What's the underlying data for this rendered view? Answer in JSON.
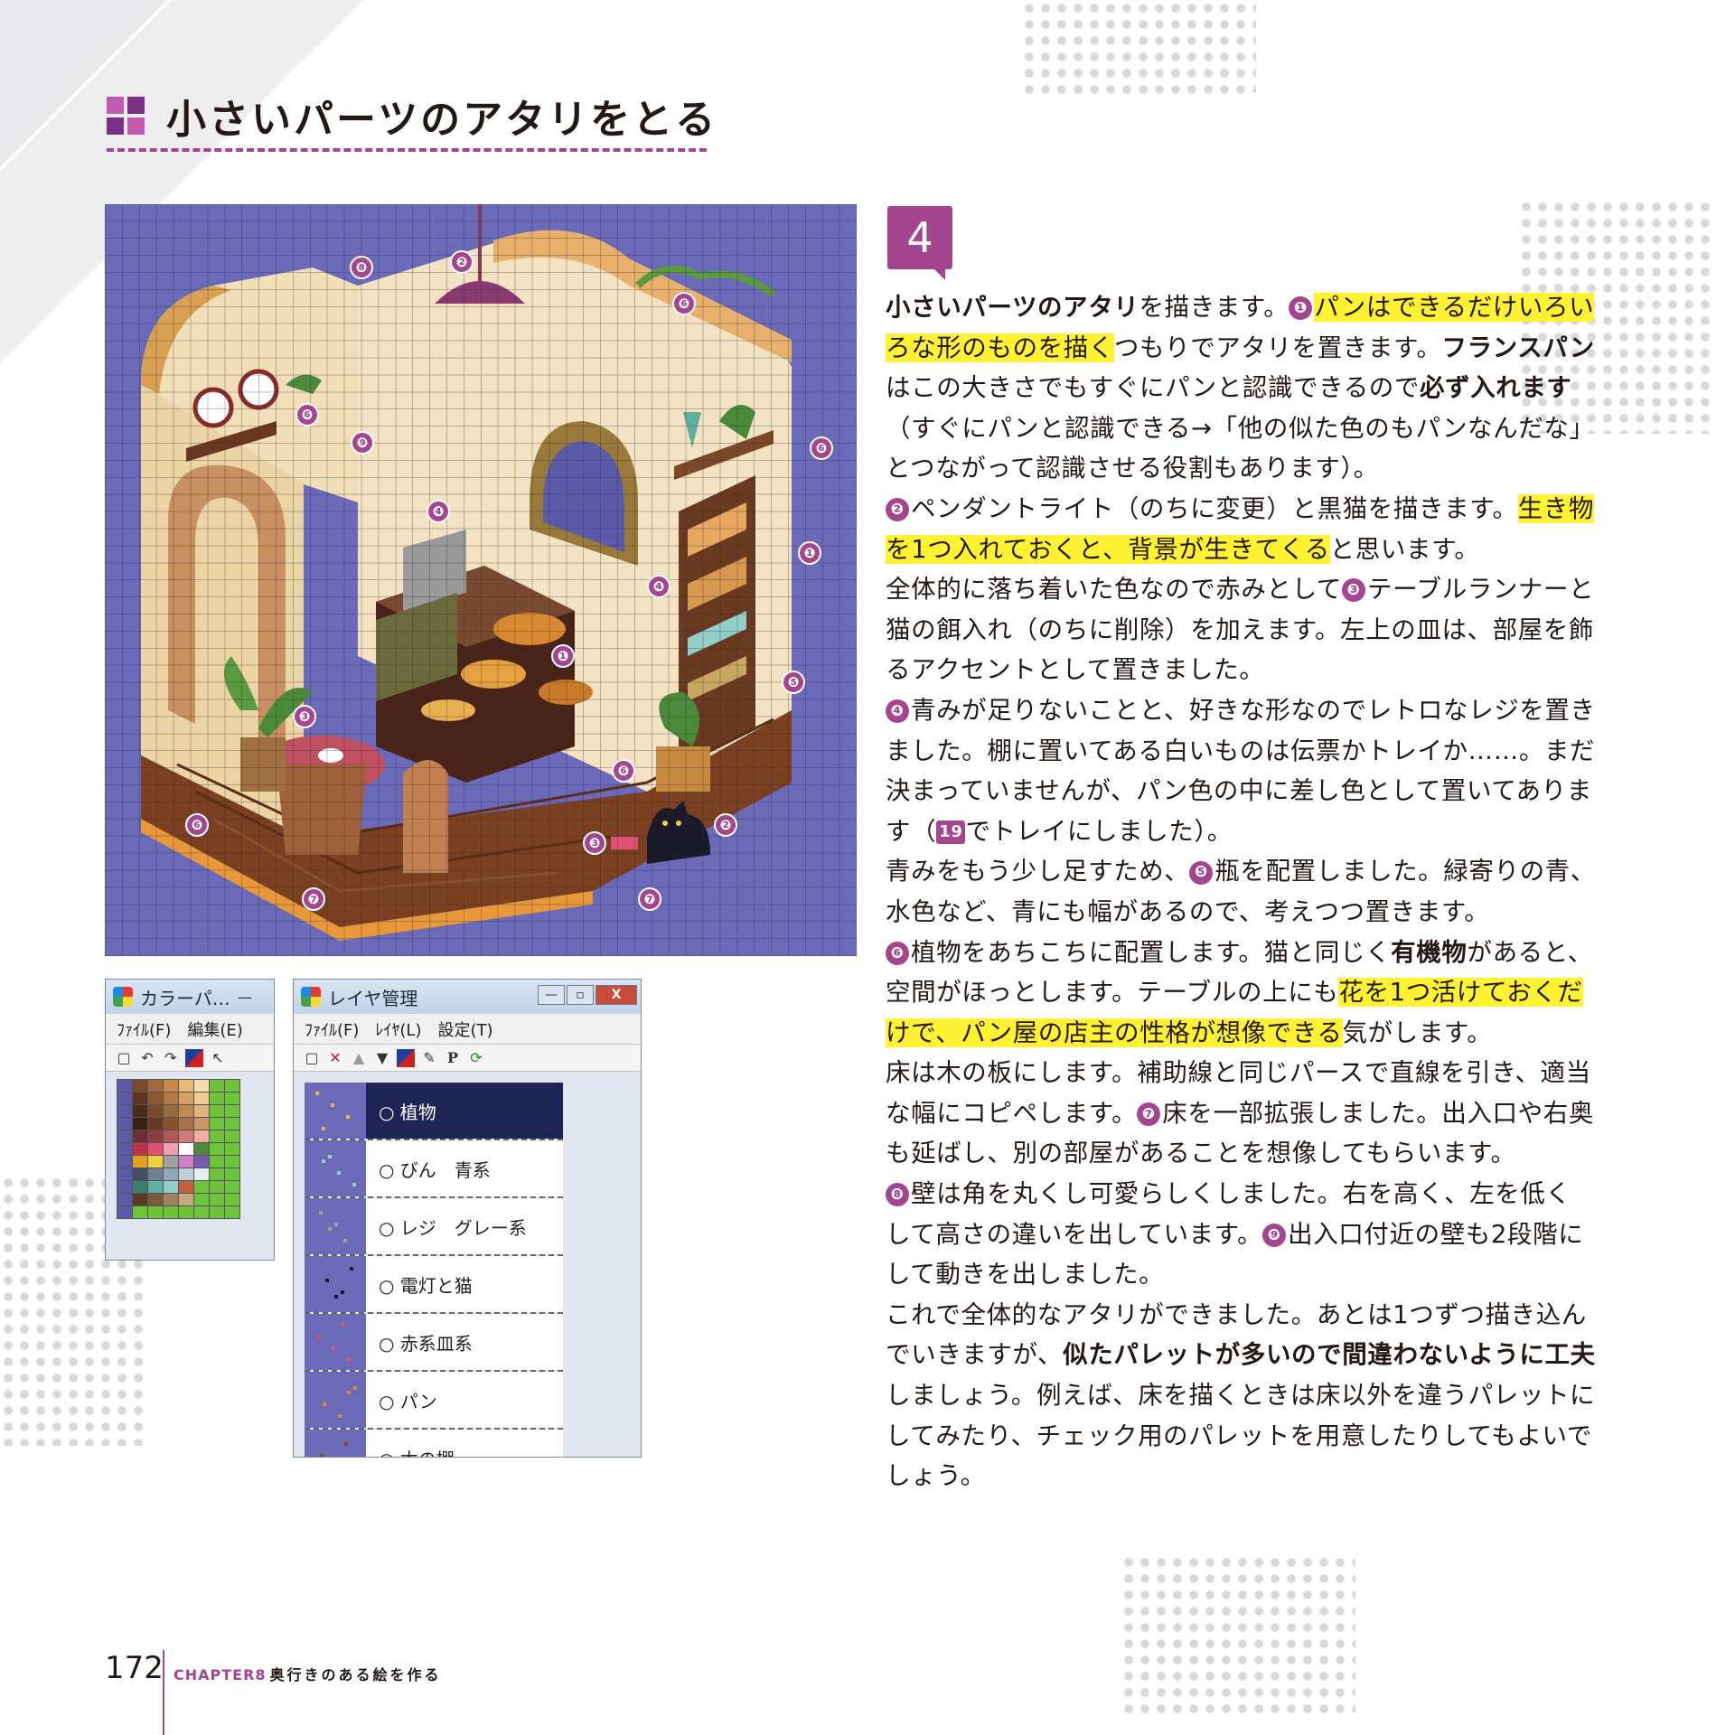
{
  "heading": {
    "title": "小さいパーツのアタリをとる"
  },
  "step": {
    "number": "4"
  },
  "markers": [
    {
      "n": "❽"
    },
    {
      "n": "❷"
    },
    {
      "n": "❻"
    },
    {
      "n": "❻"
    },
    {
      "n": "❾"
    },
    {
      "n": "❻"
    },
    {
      "n": "❹"
    },
    {
      "n": "❶"
    },
    {
      "n": "❹"
    },
    {
      "n": "❶"
    },
    {
      "n": "❺"
    },
    {
      "n": "❸"
    },
    {
      "n": "❻"
    },
    {
      "n": "❻"
    },
    {
      "n": "❷"
    },
    {
      "n": "❸"
    },
    {
      "n": "❼"
    },
    {
      "n": "❼"
    }
  ],
  "color_window": {
    "title": "カラーパ…",
    "menu": [
      "ﾌｧｲﾙ(F)",
      "編集(E)"
    ],
    "swatches": [
      "#5a5aa8",
      "#7a4a2a",
      "#a06a3a",
      "#c88a4a",
      "#e8b878",
      "#f4dcb0",
      "#6bc43a",
      "#6bc43a",
      "#5a5aa8",
      "#5c3420",
      "#8a5a32",
      "#b47a42",
      "#d8a060",
      "#f0cc90",
      "#6bc43a",
      "#6bc43a",
      "#5a5aa8",
      "#4a2a18",
      "#7a4a28",
      "#9a6a3a",
      "#c08a50",
      "#e0b47a",
      "#6bc43a",
      "#6bc43a",
      "#5a5aa8",
      "#3a2010",
      "#6a3a20",
      "#8a5030",
      "#a87048",
      "#c89868",
      "#6bc43a",
      "#6bc43a",
      "#5a5aa8",
      "#6a3030",
      "#8a4040",
      "#b05858",
      "#d07878",
      "#f0b0a0",
      "#6bc43a",
      "#6bc43a",
      "#5a5aa8",
      "#c03048",
      "#e05070",
      "#f0a0b0",
      "#ffffff",
      "#4a8a3a",
      "#6bc43a",
      "#6bc43a",
      "#5a5aa8",
      "#e0a020",
      "#f0d040",
      "#a0a0a0",
      "#d080c0",
      "#7a5ab0",
      "#6bc43a",
      "#6bc43a",
      "#5a5aa8",
      "#405060",
      "#708090",
      "#90a8b8",
      "#c0d0d8",
      "#e8eef0",
      "#6bc43a",
      "#6bc43a",
      "#5a5aa8",
      "#3a8070",
      "#60b0a0",
      "#90d0c8",
      "#c06040",
      "#6bc43a",
      "#6bc43a",
      "#6bc43a",
      "#5a5aa8",
      "#5a3a20",
      "#7a5a3a",
      "#a08060",
      "#c8a880",
      "#6bc43a",
      "#6bc43a",
      "#6bc43a",
      "#5a5aa8",
      "#6bc43a",
      "#6bc43a",
      "#6bc43a",
      "#6bc43a",
      "#6bc43a",
      "#6bc43a",
      "#6bc43a"
    ]
  },
  "layer_window": {
    "title": "レイヤ管理",
    "menu": [
      "ﾌｧｲﾙ(F)",
      "ﾚｲﾔ(L)",
      "設定(T)"
    ],
    "close_label": "X",
    "layers": [
      {
        "name": "○ 植物",
        "selected": true
      },
      {
        "name": "○ びん　青系",
        "selected": false
      },
      {
        "name": "○ レジ　グレー系",
        "selected": false
      },
      {
        "name": "○ 電灯と猫",
        "selected": false
      },
      {
        "name": "○ 赤系皿系",
        "selected": false
      },
      {
        "name": "○ パン",
        "selected": false
      },
      {
        "name": "○ 木の棚",
        "selected": false
      }
    ]
  },
  "body": {
    "p1": [
      "小さいパーツのアタリ",
      "を描きます。",
      "❶",
      "パンはできるだけいろいろな形のものを描く",
      "つもりでアタリを置きます。",
      "フランスパン",
      "はこの大きさでもすぐにパンと認識できるので",
      "必ず入れます",
      "（すぐにパンと認識できる→「他の似た色のもパンなんだな」とつながって認識させる役割もあります）。"
    ],
    "p2": [
      "❷",
      "ペンダントライト（のちに変更）と黒猫を描きます。",
      "生き物を1つ入れておくと、背景が生きてくる",
      "と思います。"
    ],
    "p3": [
      "全体的に落ち着いた色なので赤みとして",
      "❸",
      "テーブルランナーと猫の餌入れ（のちに削除）を加えます。左上の皿は、部屋を飾るアクセントとして置きました。"
    ],
    "p4": [
      "❹",
      "青みが足りないことと、好きな形なのでレトロなレジを置きました。棚に置いてある白いものは伝票かトレイか……。まだ決まっていませんが、パン色の中に差し色として置いてあります（",
      "19",
      "でトレイにしました）。"
    ],
    "p5": [
      "青みをもう少し足すため、",
      "❺",
      "瓶を配置しました。緑寄りの青、水色など、青にも幅があるので、考えつつ置きます。"
    ],
    "p6": [
      "❻",
      "植物をあちこちに配置します。猫と同じく",
      "有機物",
      "があると、空間がほっとします。テーブルの上にも",
      "花を1つ活けておくだけで、パン屋の店主の性格が想像できる",
      "気がします。"
    ],
    "p7": [
      "床は木の板にします。補助線と同じパースで直線を引き、適当な幅にコピペします。",
      "❼",
      "床を一部拡張しました。出入口や右奥も延ばし、別の部屋があることを想像してもらいます。"
    ],
    "p8": [
      "❽",
      "壁は角を丸くし可愛らしくしました。右を高く、左を低くして高さの違いを出しています。",
      "❾",
      "出入口付近の壁も2段階にして動きを出しました。"
    ],
    "p9": [
      "これで全体的なアタリができました。あとは1つずつ描き込んでいきますが、",
      "似たパレットが多いので間違わないように工夫",
      "しましょう。例えば、床を描くときは床以外を違うパレットにしてみたり、チェック用のパレットを用意したりしてもよいでしょう。"
    ]
  },
  "footer": {
    "page": "172",
    "chapter": "CHAPTER8",
    "chapter_title": "奥行きのある絵を作る"
  },
  "colors": {
    "accent": "#a3468f",
    "highlight": "#fff232",
    "illust_bg": "#6a6ab8"
  }
}
